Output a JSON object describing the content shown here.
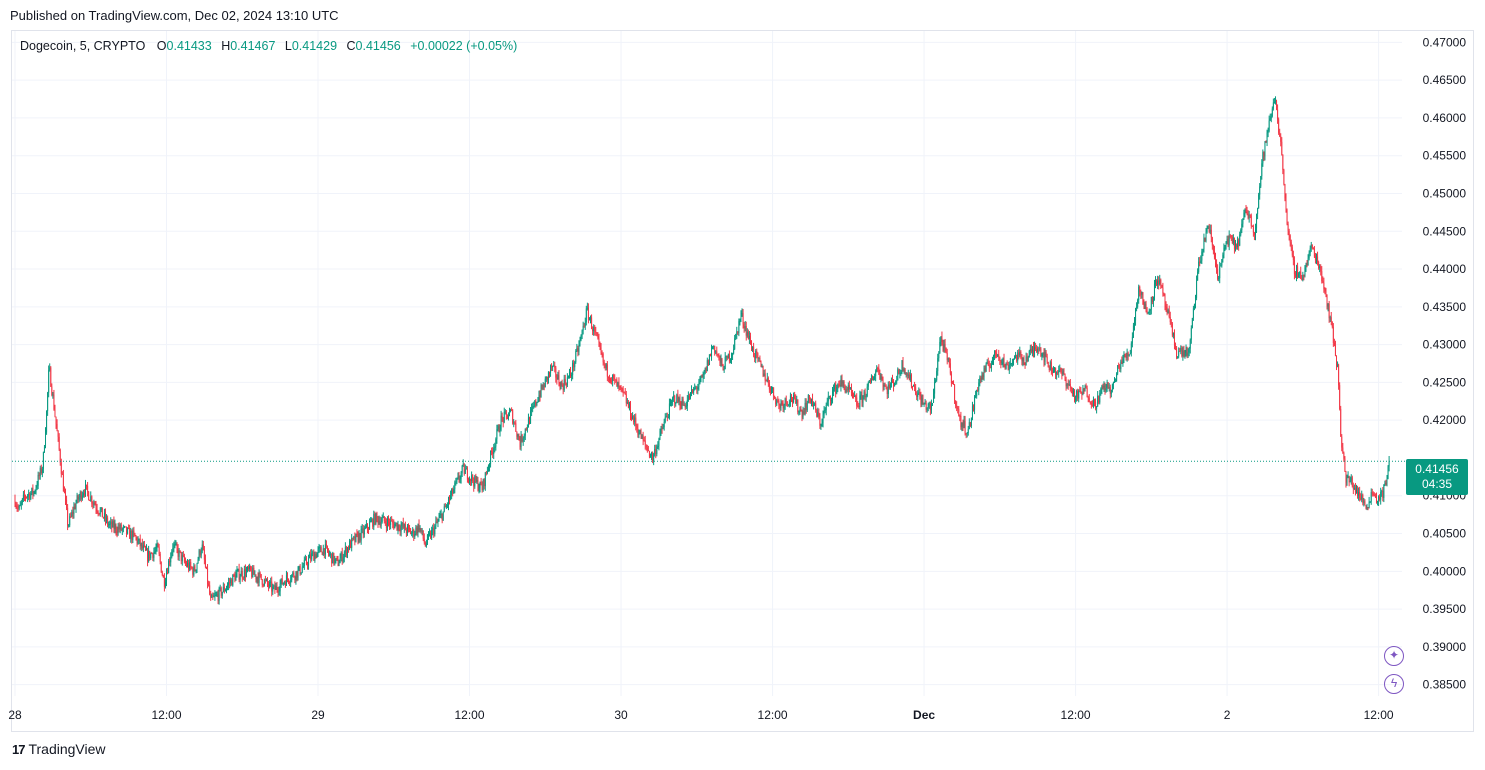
{
  "published": "Published on TradingView.com, Dec 02, 2024 13:10 UTC",
  "legend": {
    "symbol": "Dogecoin, 5, CRYPTO",
    "o_label": "O",
    "o": "0.41433",
    "h_label": "H",
    "h": "0.41467",
    "l_label": "L",
    "l": "0.41429",
    "c_label": "C",
    "c": "0.41456",
    "change": "+0.00022 (+0.05%)"
  },
  "price_tag": {
    "price": "0.41456",
    "countdown": "04:35"
  },
  "brand": {
    "name": "TradingView"
  },
  "icons": {
    "ai": "sparkle-icon",
    "flash": "lightning-icon"
  },
  "colors": {
    "up": "#089981",
    "down": "#f23645",
    "grid": "#f0f3fa",
    "last_line": "#089981"
  },
  "chart_data": {
    "type": "candlestick",
    "symbol": "Dogecoin",
    "interval": "5",
    "y_ticks": [
      "0.47000",
      "0.46500",
      "0.46000",
      "0.45500",
      "0.45000",
      "0.44500",
      "0.44000",
      "0.43500",
      "0.43000",
      "0.42500",
      "0.42000",
      "0.41000",
      "0.40500",
      "0.40000",
      "0.39500",
      "0.39000",
      "0.38500"
    ],
    "ylim": [
      0.3835,
      0.4715
    ],
    "x_ticks": [
      {
        "label": "28",
        "t": 0
      },
      {
        "label": "12:00",
        "t": 12
      },
      {
        "label": "29",
        "t": 24
      },
      {
        "label": "12:00",
        "t": 36
      },
      {
        "label": "30",
        "t": 48
      },
      {
        "label": "12:00",
        "t": 60
      },
      {
        "label": "Dec",
        "t": 72,
        "bold": true
      },
      {
        "label": "12:00",
        "t": 84
      },
      {
        "label": "2",
        "t": 96
      },
      {
        "label": "12:00",
        "t": 108
      }
    ],
    "xlim_hours": [
      0,
      109.3
    ],
    "last_price": 0.41456,
    "grid": true,
    "path_hours": [
      0,
      0.3,
      0.8,
      1.5,
      2.2,
      2.5,
      2.7,
      3.0,
      3.5,
      4.2,
      4.8,
      5.5,
      6.5,
      7.5,
      8.5,
      9.5,
      10.5,
      11.3,
      11.8,
      12.5,
      13.5,
      14.2,
      14.8,
      15.5,
      16.5,
      17.5,
      18.5,
      19.5,
      20.5,
      21.5,
      22.5,
      23.5,
      24.5,
      25.5,
      26.5,
      27.5,
      28.5,
      29.5,
      30.5,
      31.5,
      32.0,
      32.5,
      33.3,
      34.0,
      34.8,
      35.5,
      36.3,
      37.0,
      37.8,
      38.5,
      39.3,
      40.0,
      40.7,
      41.4,
      42.0,
      42.5,
      43.3,
      44.0,
      44.7,
      45.3,
      46.0,
      46.7,
      47.5,
      48.3,
      49.0,
      49.8,
      50.5,
      51.5,
      52.2,
      53.0,
      53.8,
      54.5,
      55.3,
      56.0,
      56.8,
      57.5,
      58.5,
      59.5,
      60.5,
      61.5,
      62.3,
      63.0,
      63.8,
      64.5,
      65.3,
      66.0,
      66.7,
      67.5,
      68.3,
      69.0,
      69.8,
      70.3,
      71.0,
      72.0,
      72.6,
      73.3,
      74.0,
      74.8,
      75.5,
      76.3,
      77.0,
      77.8,
      78.5,
      79.3,
      80.0,
      81.0,
      82.0,
      83.0,
      84.0,
      84.8,
      85.5,
      86.3,
      86.9,
      87.5,
      88.3,
      89.0,
      89.7,
      90.5,
      91.3,
      92.0,
      93.0,
      93.7,
      94.5,
      95.3,
      96.0,
      96.8,
      97.5,
      98.2,
      98.8,
      99.2,
      99.8,
      100.4,
      100.8,
      101.3,
      102.0,
      102.7,
      103.4,
      104.0,
      104.5,
      104.8,
      105.0,
      105.4,
      105.8,
      106.5,
      107.0,
      107.5,
      108.0,
      108.5,
      108.9
    ],
    "path_price": [
      0.4095,
      0.408,
      0.41,
      0.4105,
      0.414,
      0.421,
      0.427,
      0.423,
      0.416,
      0.406,
      0.409,
      0.411,
      0.4085,
      0.406,
      0.4055,
      0.4045,
      0.402,
      0.403,
      0.3985,
      0.4035,
      0.401,
      0.4,
      0.4035,
      0.396,
      0.3975,
      0.3995,
      0.4,
      0.399,
      0.3975,
      0.399,
      0.4,
      0.402,
      0.403,
      0.401,
      0.4035,
      0.405,
      0.407,
      0.4065,
      0.406,
      0.405,
      0.406,
      0.4035,
      0.406,
      0.408,
      0.411,
      0.4135,
      0.412,
      0.411,
      0.416,
      0.42,
      0.421,
      0.417,
      0.42,
      0.423,
      0.425,
      0.427,
      0.4245,
      0.426,
      0.43,
      0.4345,
      0.431,
      0.427,
      0.425,
      0.423,
      0.42,
      0.417,
      0.415,
      0.42,
      0.423,
      0.422,
      0.424,
      0.4255,
      0.43,
      0.427,
      0.429,
      0.434,
      0.429,
      0.4255,
      0.422,
      0.423,
      0.421,
      0.423,
      0.4195,
      0.423,
      0.425,
      0.424,
      0.422,
      0.424,
      0.427,
      0.424,
      0.4255,
      0.4275,
      0.425,
      0.422,
      0.4215,
      0.431,
      0.427,
      0.42,
      0.4185,
      0.425,
      0.427,
      0.429,
      0.427,
      0.4285,
      0.428,
      0.43,
      0.427,
      0.426,
      0.423,
      0.424,
      0.422,
      0.4245,
      0.424,
      0.4275,
      0.429,
      0.4375,
      0.434,
      0.439,
      0.434,
      0.429,
      0.429,
      0.44,
      0.446,
      0.439,
      0.444,
      0.443,
      0.448,
      0.445,
      0.4545,
      0.458,
      0.463,
      0.454,
      0.445,
      0.44,
      0.439,
      0.443,
      0.44,
      0.435,
      0.43,
      0.426,
      0.4185,
      0.412,
      0.412,
      0.41,
      0.4085,
      0.4105,
      0.4095,
      0.411,
      0.4145
    ]
  }
}
